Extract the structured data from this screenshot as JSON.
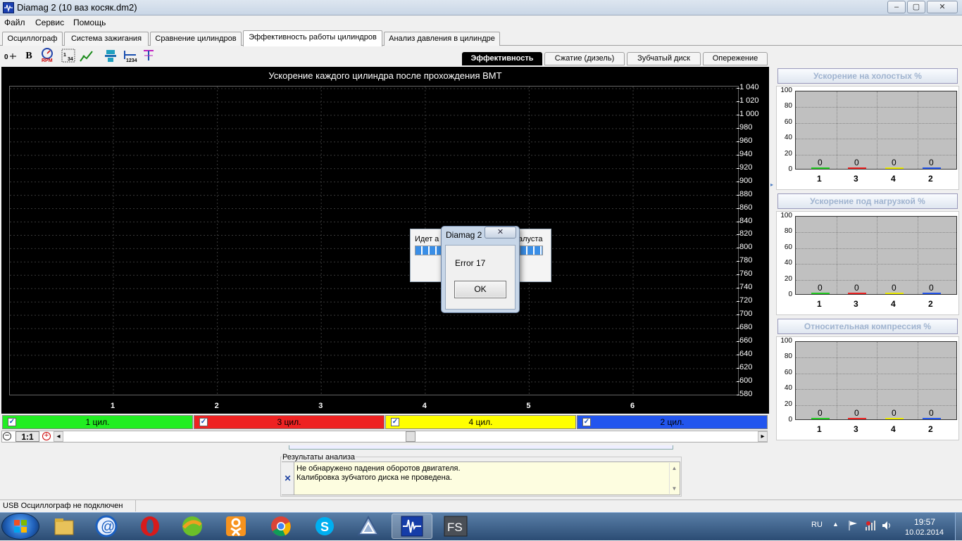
{
  "window": {
    "title": "Diamag 2 (10 ваз косяк.dm2)",
    "min": "–",
    "max": "▢",
    "close": "✕"
  },
  "menu": [
    "Файл",
    "Сервис",
    "Помощь"
  ],
  "tabs": [
    "Осциллограф",
    "Система зажигания",
    "Сравнение цилиндров",
    "Эффективность работы цилиндров",
    "Анализ давления в цилиндре"
  ],
  "active_tab": 3,
  "subtabs": [
    "Эффективность",
    "Сжатие (дизель)",
    "Зубчатый диск",
    "Опережение"
  ],
  "active_subtab": 0,
  "toolbar_icons": [
    "zoom-value-icon",
    "bold-icon",
    "rpm-icon",
    "scale-icon",
    "graph-icon",
    "cylinder-icon",
    "numbering-icon",
    "marker-icon"
  ],
  "toolbar_text": {
    "bold": "B",
    "rpm": "RPM",
    "scale": "1234",
    "num": "1234"
  },
  "main_chart": {
    "title": "Ускорение каждого цилиндра после прохождения ВМТ",
    "y_ticks": [
      "1 040",
      "1 020",
      "1 000",
      "980",
      "960",
      "940",
      "920",
      "900",
      "880",
      "860",
      "840",
      "820",
      "800",
      "780",
      "760",
      "740",
      "720",
      "700",
      "680",
      "660",
      "640",
      "620",
      "600",
      "580"
    ],
    "x_ticks": [
      "1",
      "2",
      "3",
      "4",
      "5",
      "6"
    ]
  },
  "cylinders": [
    {
      "label": "1 цил.",
      "color": "#22ee22",
      "check": "✓"
    },
    {
      "label": "3 цил.",
      "color": "#ee2222",
      "check": "✓"
    },
    {
      "label": "4 цил.",
      "color": "#ffff00",
      "check": "✓"
    },
    {
      "label": "2 цил.",
      "color": "#2255ee",
      "check": "✓"
    }
  ],
  "zoom": {
    "minus": "−",
    "ratio": "1:1",
    "plus": "+",
    "left": "◂",
    "right": "▸"
  },
  "mini_charts": [
    {
      "title": "Ускорение на холостых %",
      "y_ticks": [
        "100",
        "80",
        "60",
        "40",
        "20",
        "0"
      ],
      "labels": [
        "1",
        "3",
        "4",
        "2"
      ],
      "values": [
        0,
        0,
        0,
        0
      ]
    },
    {
      "title": "Ускорение под нагрузкой %",
      "y_ticks": [
        "100",
        "80",
        "60",
        "40",
        "20",
        "0"
      ],
      "labels": [
        "1",
        "3",
        "4",
        "2"
      ],
      "values": [
        0,
        0,
        0,
        0
      ]
    },
    {
      "title": "Относительная компрессия %",
      "y_ticks": [
        "100",
        "80",
        "60",
        "40",
        "20",
        "0"
      ],
      "labels": [
        "1",
        "3",
        "4",
        "2"
      ],
      "values": [
        0,
        0,
        0,
        0
      ]
    }
  ],
  "mini_colors": [
    "#22cc22",
    "#ee2222",
    "#eeee00",
    "#2255ee"
  ],
  "results": {
    "legend": "Результаты анализа",
    "close": "✕",
    "lines": [
      "Не обнаружено падения оборотов двигателя.",
      "Калибровка зубчатого диска не проведена."
    ]
  },
  "progress_dialog": {
    "text_left": "Идет а",
    "text_right": "алуста"
  },
  "dialog": {
    "title": "Diamag 2",
    "message": "Error 17",
    "ok": "OK",
    "close": "✕"
  },
  "status": "USB Осциллограф не подключен",
  "tray": {
    "lang": "RU",
    "time": "19:57",
    "date": "10.02.2014"
  },
  "taskbar_apps": [
    "explorer",
    "mail",
    "opera",
    "app-green",
    "odnoklassniki",
    "chrome",
    "skype",
    "app-tri",
    "diamag",
    "fs"
  ]
}
